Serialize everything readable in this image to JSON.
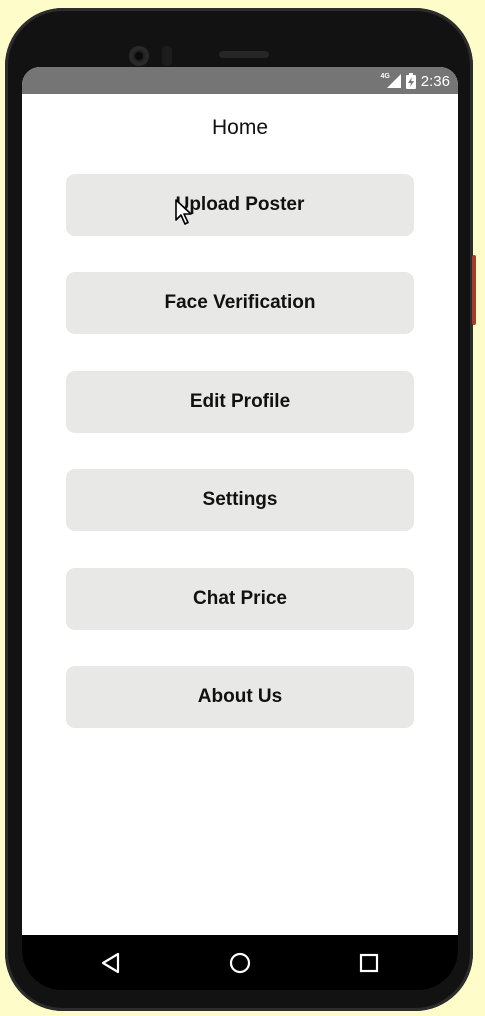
{
  "status_bar": {
    "network": "4G",
    "time": "2:36"
  },
  "header": {
    "title": "Home"
  },
  "menu": {
    "items": [
      {
        "label": "Upload Poster"
      },
      {
        "label": "Face Verification"
      },
      {
        "label": "Edit Profile"
      },
      {
        "label": "Settings"
      },
      {
        "label": "Chat Price"
      },
      {
        "label": "About Us"
      }
    ]
  },
  "nav_bar": {
    "icons": [
      "back-icon",
      "home-icon",
      "recents-icon"
    ]
  },
  "colors": {
    "background": "#fefcc8",
    "status_bar": "#757575",
    "button_bg": "#e8e8e6",
    "phone_frame": "#121212"
  }
}
